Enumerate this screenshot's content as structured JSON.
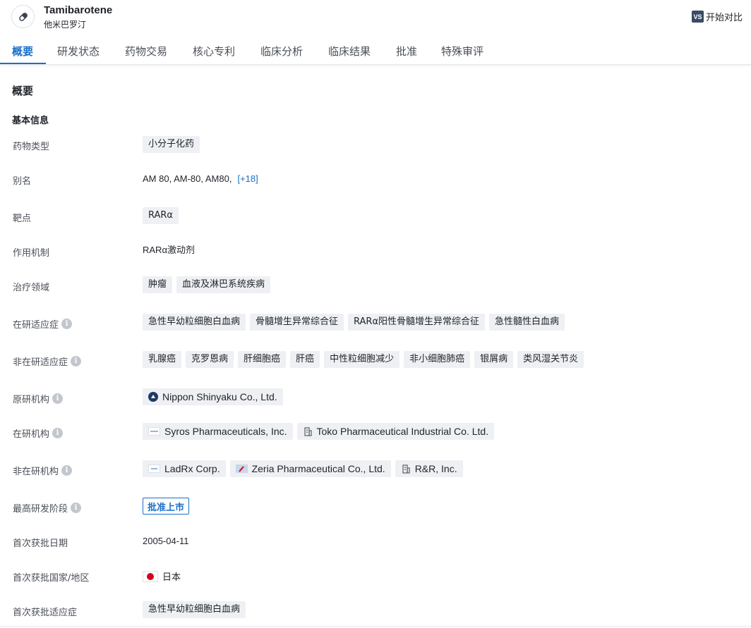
{
  "header": {
    "drug_name": "Tamibarotene",
    "drug_name_cn": "他米巴罗汀",
    "compare_icon": "VS",
    "compare_label": "开始对比"
  },
  "tabs": [
    {
      "label": "概要"
    },
    {
      "label": "研发状态"
    },
    {
      "label": "药物交易"
    },
    {
      "label": "核心专利"
    },
    {
      "label": "临床分析"
    },
    {
      "label": "临床结果"
    },
    {
      "label": "批准"
    },
    {
      "label": "特殊审评"
    }
  ],
  "section_title": "概要",
  "sub_title": "基本信息",
  "fields": {
    "drug_type": {
      "label": "药物类型",
      "tags": [
        "小分子化药"
      ]
    },
    "alias": {
      "label": "别名",
      "text": "AM 80,  AM-80,  AM80,",
      "more": "[+18]"
    },
    "target": {
      "label": "靶点",
      "tags": [
        "RARα"
      ]
    },
    "mechanism": {
      "label": "作用机制",
      "text": "RARα激动剂"
    },
    "therapeutic_area": {
      "label": "治疗领域",
      "tags": [
        "肿瘤",
        "血液及淋巴系统疾病"
      ]
    },
    "active_indications": {
      "label": "在研适应症",
      "tags": [
        "急性早幼粒细胞白血病",
        "骨髓增生异常综合征",
        "RARα阳性骨髓增生异常综合征",
        "急性髓性白血病"
      ]
    },
    "inactive_indications": {
      "label": "非在研适应症",
      "tags": [
        "乳腺癌",
        "克罗恩病",
        "肝细胞癌",
        "肝癌",
        "中性粒细胞减少",
        "非小细胞肺癌",
        "银屑病",
        "类风湿关节炎"
      ]
    },
    "originator": {
      "label": "原研机构",
      "orgs": [
        "Nippon Shinyaku Co., Ltd."
      ]
    },
    "active_orgs": {
      "label": "在研机构",
      "orgs": [
        "Syros Pharmaceuticals, Inc.",
        "Toko Pharmaceutical Industrial Co. Ltd."
      ]
    },
    "inactive_orgs": {
      "label": "非在研机构",
      "orgs": [
        "LadRx Corp.",
        "Zeria Pharmaceutical Co., Ltd.",
        "R&R, Inc."
      ]
    },
    "highest_phase": {
      "label": "最高研发阶段",
      "value": "批准上市"
    },
    "first_approval_date": {
      "label": "首次获批日期",
      "value": "2005-04-11"
    },
    "first_approval_country": {
      "label": "首次获批国家/地区",
      "value": "日本"
    },
    "first_approval_indication": {
      "label": "首次获批适应症",
      "tags": [
        "急性早幼粒细胞白血病"
      ]
    }
  },
  "colors": {
    "accent": "#1a6fc9",
    "tag_bg": "#eef0f3",
    "flag_red": "#d0021b"
  }
}
